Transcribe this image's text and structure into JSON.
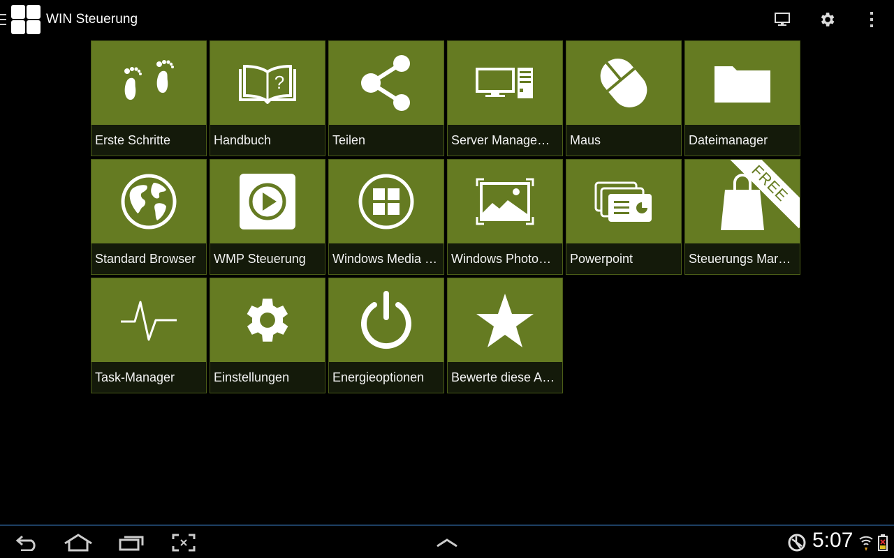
{
  "app": {
    "title": "WIN Steuerung"
  },
  "colors": {
    "tile": "#657b22",
    "tile_label_bg": "#141a0a",
    "navbar_line": "#1d3f63"
  },
  "tiles": [
    {
      "label": "Erste Schritte",
      "icon": "footprints-icon"
    },
    {
      "label": "Handbuch",
      "icon": "book-question-icon"
    },
    {
      "label": "Teilen",
      "icon": "share-icon"
    },
    {
      "label": "Server Managem...",
      "icon": "server-computer-icon"
    },
    {
      "label": "Maus",
      "icon": "mouse-icon"
    },
    {
      "label": "Dateimanager",
      "icon": "folder-icon"
    },
    {
      "label": "Standard Browser",
      "icon": "globe-icon"
    },
    {
      "label": "WMP Steuerung",
      "icon": "play-icon"
    },
    {
      "label": "Windows Media C...",
      "icon": "windows-logo-icon"
    },
    {
      "label": "Windows PhotoVi...",
      "icon": "photo-icon"
    },
    {
      "label": "Powerpoint",
      "icon": "presentation-icon"
    },
    {
      "label": "Steuerungs Markt...",
      "icon": "shopping-bag-icon",
      "ribbon": "FREE"
    },
    {
      "label": "Task-Manager",
      "icon": "pulse-icon"
    },
    {
      "label": "Einstellungen",
      "icon": "gear-icon"
    },
    {
      "label": "Energieoptionen",
      "icon": "power-icon"
    },
    {
      "label": "Bewerte diese App!",
      "icon": "star-icon"
    }
  ],
  "status": {
    "time": "5:07"
  }
}
